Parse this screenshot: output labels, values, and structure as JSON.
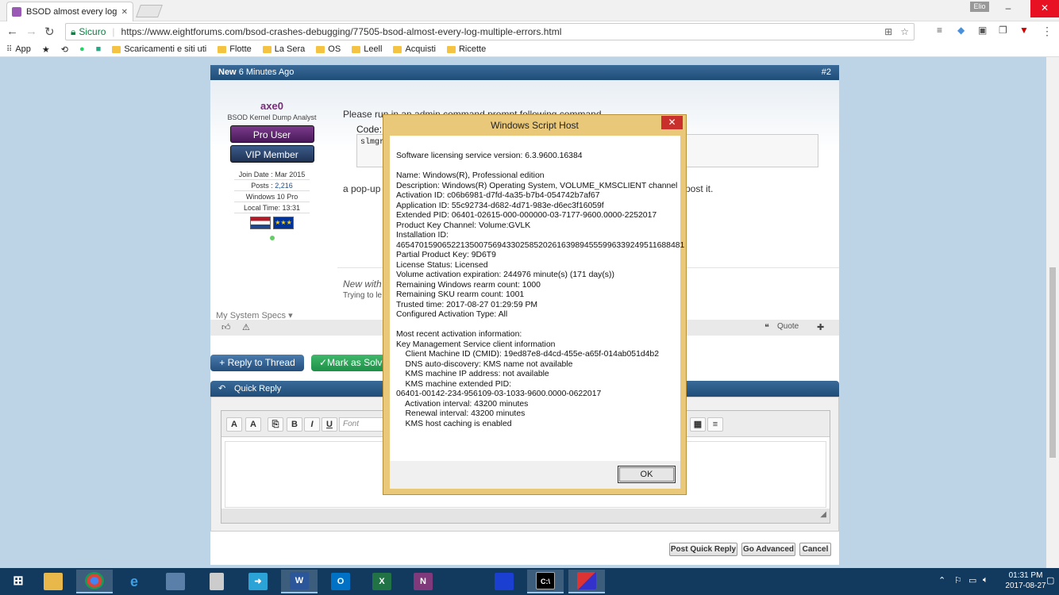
{
  "browser": {
    "tab_title": "BSOD almost every log c",
    "tab_close": "✕",
    "user_badge": "Elio",
    "security_label": "Sicuro",
    "url": "https://www.eightforums.com/bsod-crashes-debugging/77505-bsod-almost-every-log-multiple-errors.html",
    "bookmarks": [
      "App",
      "Scaricamenti e siti uti",
      "Flotte",
      "La Sera",
      "OS",
      "Leell",
      "Acquisti",
      "Ricette"
    ]
  },
  "post": {
    "new_label": "New",
    "time_ago": "6 Minutes Ago",
    "post_number": "#2",
    "username": "axe0",
    "user_title": "BSOD Kernel Dump Analyst",
    "badge_pro": "Pro User",
    "badge_vip": "VIP Member",
    "join_date": "Join Date : Mar 2015",
    "posts_label": "Posts : ",
    "posts_count": "2,216",
    "os": "Windows 10 Pro",
    "local_time": "Local Time: 13:31",
    "flag_eu_stars": "★★★",
    "message_line1": "Please run in an admin command prompt following command",
    "code_label": "Code:",
    "code_text": "slmgr",
    "message_line2_left": "a pop-up",
    "message_line2_right": "post it.",
    "new_with": "New with",
    "trying": "Trying to le",
    "system_specs": "My System Specs",
    "quote": "Quote"
  },
  "buttons": {
    "reply_thread": "+ Reply to Thread",
    "mark_solved": "✓Mark as Solv",
    "quick_reply": "Quick Reply",
    "font_placeholder": "Font",
    "post_quick_reply": "Post Quick Reply",
    "go_advanced": "Go Advanced",
    "cancel": "Cancel"
  },
  "dialog": {
    "title": "Windows Script Host",
    "close": "✕",
    "ok": "OK",
    "lines": [
      "Software licensing service version: 6.3.9600.16384",
      "",
      "Name: Windows(R), Professional edition",
      "Description: Windows(R) Operating System, VOLUME_KMSCLIENT channel",
      "Activation ID: c06b6981-d7fd-4a35-b7b4-054742b7af67",
      "Application ID: 55c92734-d682-4d71-983e-d6ec3f16059f",
      "Extended PID: 06401-02615-000-000000-03-7177-9600.0000-2252017",
      "Product Key Channel: Volume:GVLK",
      "Installation ID:",
      "465470159065221350075694330258520261639894555996339249511688481",
      "Partial Product Key: 9D6T9",
      "License Status: Licensed",
      "Volume activation expiration: 244976 minute(s) (171 day(s))",
      "Remaining Windows rearm count: 1000",
      "Remaining SKU rearm count: 1001",
      "Trusted time: 2017-08-27 01:29:59 PM",
      "Configured Activation Type: All",
      "",
      "Most recent activation information:",
      "Key Management Service client information",
      "    Client Machine ID (CMID): 19ed87e8-d4cd-455e-a65f-014ab051d4b2",
      "    DNS auto-discovery: KMS name not available",
      "    KMS machine IP address: not available",
      "    KMS machine extended PID:",
      "06401-00142-234-956109-03-1033-9600.0000-0622017",
      "    Activation interval: 43200 minutes",
      "    Renewal interval: 43200 minutes",
      "    KMS host caching is enabled"
    ]
  },
  "taskbar": {
    "time": "01:31 PM",
    "date": "2017-08-27"
  }
}
